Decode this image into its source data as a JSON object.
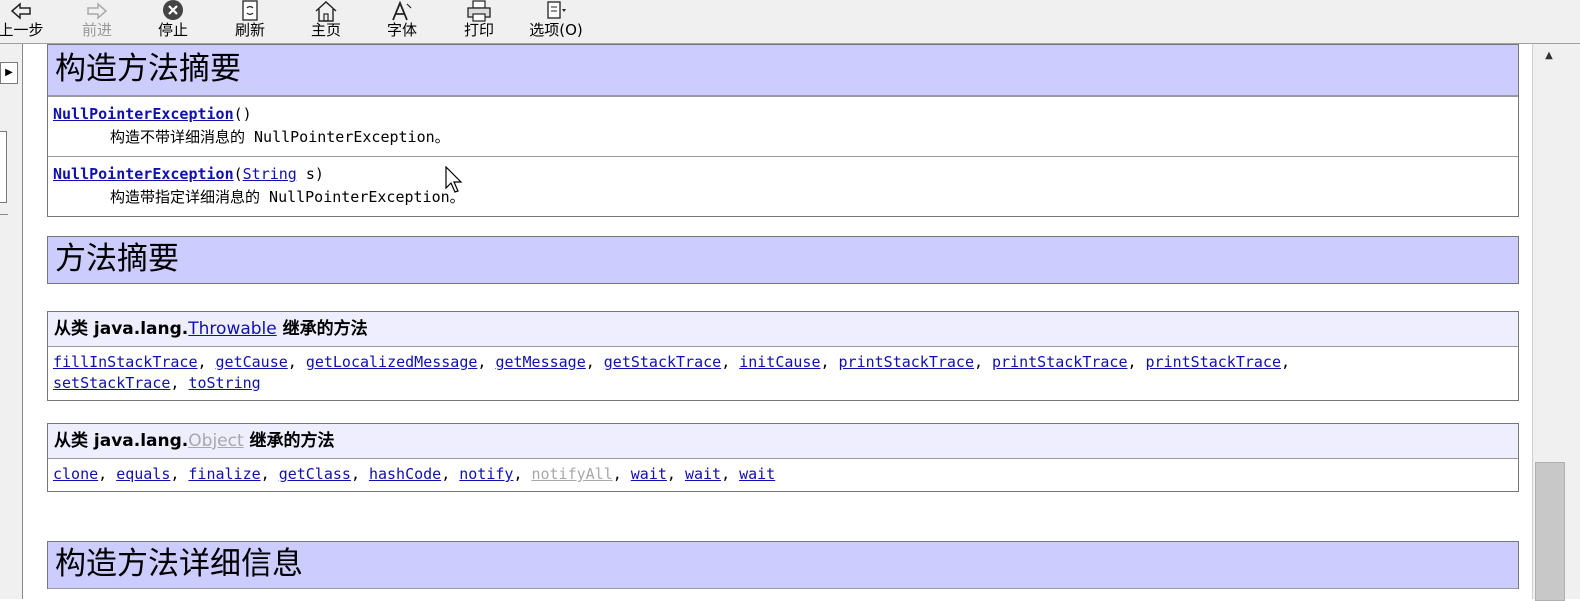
{
  "toolbar": {
    "buttons": [
      {
        "label": "上一步",
        "icon": "back-arrow-icon"
      },
      {
        "label": "前进",
        "icon": "forward-arrow-icon"
      },
      {
        "label": "停止",
        "icon": "stop-icon"
      },
      {
        "label": "刷新",
        "icon": "refresh-icon"
      },
      {
        "label": "主页",
        "icon": "home-icon"
      },
      {
        "label": "字体",
        "icon": "font-icon"
      },
      {
        "label": "打印",
        "icon": "print-icon"
      },
      {
        "label": "选项(O)",
        "icon": "options-icon"
      }
    ]
  },
  "constructor_summary": {
    "title": "构造方法摘要",
    "rows": [
      {
        "name": "NullPointerException",
        "params_open": "(",
        "param_type": "",
        "param_rest": ")",
        "desc": "构造不带详细消息的 NullPointerException。"
      },
      {
        "name": "NullPointerException",
        "params_open": "(",
        "param_type": "String",
        "param_rest": " s)",
        "desc": "构造带指定详细消息的 NullPointerException。"
      }
    ]
  },
  "method_summary": {
    "title": "方法摘要"
  },
  "inherited_throwable": {
    "prefix": "从类  java.lang.",
    "class_name": "Throwable",
    "suffix": " 继承的方法",
    "methods": [
      "fillInStackTrace",
      "getCause",
      "getLocalizedMessage",
      "getMessage",
      "getStackTrace",
      "initCause",
      "printStackTrace",
      "printStackTrace",
      "printStackTrace",
      "setStackTrace",
      "toString"
    ]
  },
  "inherited_object": {
    "prefix": "从类  java.lang.",
    "class_name": "Object",
    "suffix": " 继承的方法",
    "methods": [
      "clone",
      "equals",
      "finalize",
      "getClass",
      "hashCode",
      "notify",
      "notifyAll",
      "wait",
      "wait",
      "wait"
    ]
  },
  "constructor_detail": {
    "title": "构造方法详细信息"
  },
  "colors": {
    "header_bg": "#ccccff",
    "subheader_bg": "#eeeeff",
    "link": "#1010b0",
    "disabled": "#a8a8a8"
  }
}
